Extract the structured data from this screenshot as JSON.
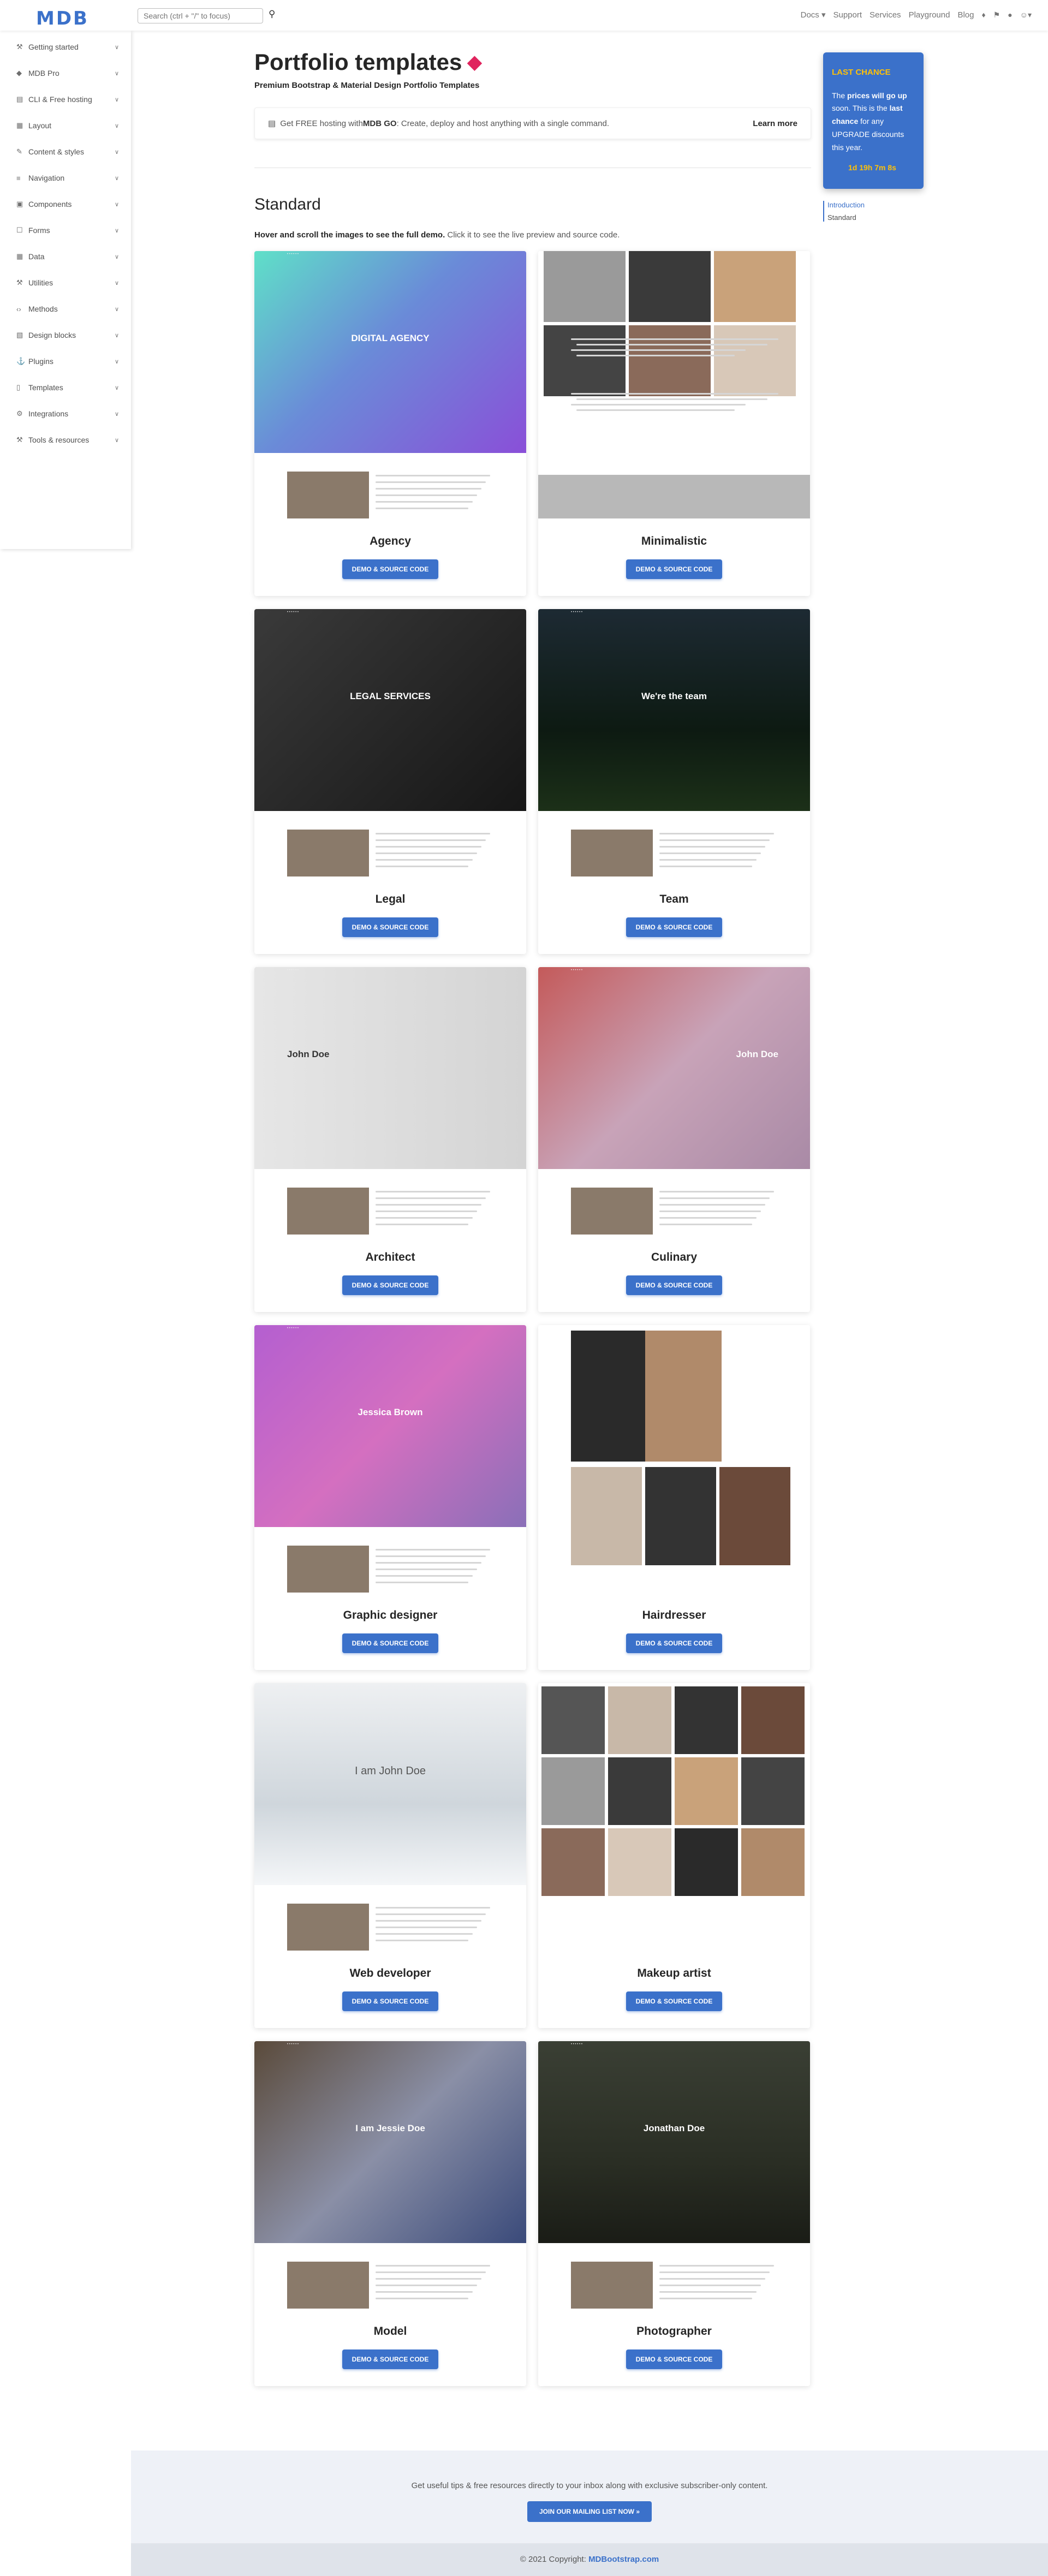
{
  "header": {
    "logo": "MDB",
    "search_placeholder": "Search (ctrl + \"/\" to focus)",
    "nav": [
      "Docs ▾",
      "Support",
      "Services",
      "Playground",
      "Blog"
    ]
  },
  "sidebar": {
    "items": [
      {
        "label": "Getting started",
        "icon": "graduation-icon"
      },
      {
        "label": "MDB Pro",
        "icon": "gem-icon"
      },
      {
        "label": "CLI & Free hosting",
        "icon": "server-icon"
      },
      {
        "label": "Layout",
        "icon": "layout-icon"
      },
      {
        "label": "Content & styles",
        "icon": "brush-icon"
      },
      {
        "label": "Navigation",
        "icon": "bars-icon"
      },
      {
        "label": "Components",
        "icon": "cubes-icon"
      },
      {
        "label": "Forms",
        "icon": "forms-icon"
      },
      {
        "label": "Data",
        "icon": "table-icon"
      },
      {
        "label": "Utilities",
        "icon": "wrench-icon"
      },
      {
        "label": "Methods",
        "icon": "code-icon"
      },
      {
        "label": "Design blocks",
        "icon": "blocks-icon"
      },
      {
        "label": "Plugins",
        "icon": "plug-icon"
      },
      {
        "label": "Templates",
        "icon": "file-icon"
      },
      {
        "label": "Integrations",
        "icon": "cogs-icon"
      },
      {
        "label": "Tools & resources",
        "icon": "tools-icon"
      }
    ]
  },
  "page": {
    "title": "Portfolio templates",
    "subtitle": "Premium Bootstrap & Material Design Portfolio Templates",
    "promo_text": "Get FREE hosting with ",
    "promo_bold": "MDB GO",
    "promo_rest": ": Create, deploy and host anything with a single command.",
    "promo_link": "Learn more",
    "section": "Standard",
    "hint_bold": "Hover and scroll the images to see the full demo.",
    "hint_rest": " Click it to see the live preview and source code."
  },
  "cards": [
    {
      "name": "Agency",
      "button": "DEMO & SOURCE CODE",
      "hero": "DIGITAL AGENCY",
      "bg": "linear-gradient(135deg,#5fe0c8 0%,#6a8bd8 45%,#8a4fd8 100%)"
    },
    {
      "name": "Minimalistic",
      "button": "DEMO & SOURCE CODE",
      "hero": "",
      "bg": "#ffffff"
    },
    {
      "name": "Legal",
      "button": "DEMO & SOURCE CODE",
      "hero": "LEGAL SERVICES",
      "bg": "linear-gradient(135deg,#3a3a3a,#161616)"
    },
    {
      "name": "Team",
      "button": "DEMO & SOURCE CODE",
      "hero": "We're the team",
      "bg": "linear-gradient(180deg,#1d2a33,#0d1a12 60%,#1c3018)"
    },
    {
      "name": "Architect",
      "button": "DEMO & SOURCE CODE",
      "hero": "John Doe",
      "bg": "linear-gradient(90deg,#e6e6e6,#d4d4d4)"
    },
    {
      "name": "Culinary",
      "button": "DEMO & SOURCE CODE",
      "hero": "John Doe",
      "bg": "linear-gradient(135deg,#c45a5a,#c8a3b8 50%,#a98aa6)"
    },
    {
      "name": "Graphic designer",
      "button": "DEMO & SOURCE CODE",
      "hero": "Jessica Brown",
      "bg": "linear-gradient(135deg,#b45fd0,#d46fc0 50%,#8a6fb8)"
    },
    {
      "name": "Hairdresser",
      "button": "DEMO & SOURCE CODE",
      "hero": "",
      "bg": "#ffffff"
    },
    {
      "name": "Web developer",
      "button": "DEMO & SOURCE CODE",
      "hero": "I am John Doe",
      "bg": "linear-gradient(180deg,#eef0f2,#cfd6dc 60%,#f4f6f8)"
    },
    {
      "name": "Makeup artist",
      "button": "DEMO & SOURCE CODE",
      "hero": "",
      "bg": "#ffffff"
    },
    {
      "name": "Model",
      "button": "DEMO & SOURCE CODE",
      "hero": "I am Jessie Doe",
      "bg": "linear-gradient(135deg,#5a4a3a,#8a8fa6 50%,#3a4a7a)"
    },
    {
      "name": "Photographer",
      "button": "DEMO & SOURCE CODE",
      "hero": "Jonathan Doe",
      "bg": "linear-gradient(180deg,#3a3f34,#2a2e24 60%,#1a1c16)"
    }
  ],
  "toc": {
    "card_title": "LAST CHANCE",
    "card_text_1": "The ",
    "card_b1": "prices will go up",
    "card_text_2": " soon. This is the ",
    "card_b2": "last chance",
    "card_text_3": " for any UPGRADE discounts this year.",
    "countdown": "1d 19h 7m 8s",
    "links": [
      "Introduction",
      "Standard"
    ]
  },
  "footer": {
    "text": "Get useful tips & free resources directly to your inbox along with exclusive subscriber-only content.",
    "button": "JOIN OUR MAILING LIST NOW",
    "copyright": "© 2021 Copyright: ",
    "copyright_link": "MDBootstrap.com"
  }
}
